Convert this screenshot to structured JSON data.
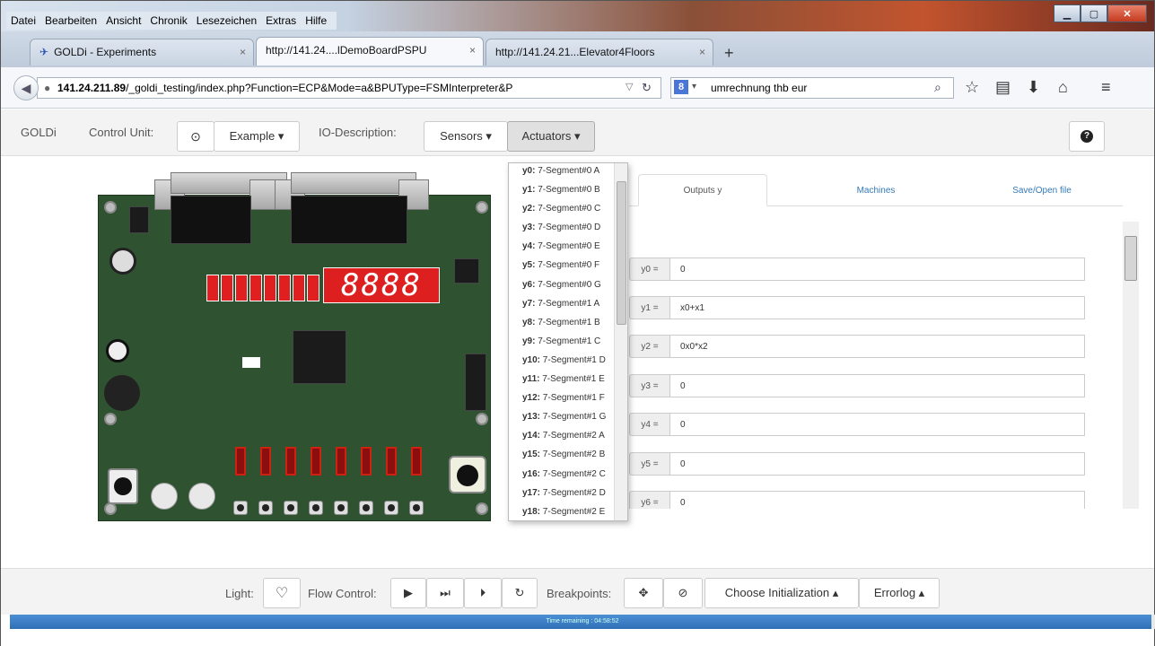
{
  "menubar": [
    "Datei",
    "Bearbeiten",
    "Ansicht",
    "Chronik",
    "Lesezeichen",
    "Extras",
    "Hilfe"
  ],
  "tabs": [
    {
      "title": "GOLDi - Experiments",
      "close": "×"
    },
    {
      "title": "http://141.24....lDemoBoardPSPU",
      "close": "×"
    },
    {
      "title": "http://141.24.21...Elevator4Floors",
      "close": "×"
    }
  ],
  "url": {
    "host": "141.24.211.89",
    "path": "/_goldi_testing/index.php?Function=ECP&Mode=a&BPUType=FSMInterpreter&P"
  },
  "search": {
    "value": "umrechnung thb eur"
  },
  "toolbar": {
    "brand": "GOLDi",
    "control_unit_label": "Control Unit:",
    "example": "Example ▾",
    "io_label": "IO-Description:",
    "sensors": "Sensors ▾",
    "actuators": "Actuators ▾"
  },
  "actuators_menu": [
    {
      "id": "y0:",
      "name": "7-Segment#0 A"
    },
    {
      "id": "y1:",
      "name": "7-Segment#0 B"
    },
    {
      "id": "y2:",
      "name": "7-Segment#0 C"
    },
    {
      "id": "y3:",
      "name": "7-Segment#0 D"
    },
    {
      "id": "y4:",
      "name": "7-Segment#0 E"
    },
    {
      "id": "y5:",
      "name": "7-Segment#0 F"
    },
    {
      "id": "y6:",
      "name": "7-Segment#0 G"
    },
    {
      "id": "y7:",
      "name": "7-Segment#1 A"
    },
    {
      "id": "y8:",
      "name": "7-Segment#1 B"
    },
    {
      "id": "y9:",
      "name": "7-Segment#1 C"
    },
    {
      "id": "y10:",
      "name": "7-Segment#1 D"
    },
    {
      "id": "y11:",
      "name": "7-Segment#1 E"
    },
    {
      "id": "y12:",
      "name": "7-Segment#1 F"
    },
    {
      "id": "y13:",
      "name": "7-Segment#1 G"
    },
    {
      "id": "y14:",
      "name": "7-Segment#2 A"
    },
    {
      "id": "y15:",
      "name": "7-Segment#2 B"
    },
    {
      "id": "y16:",
      "name": "7-Segment#2 C"
    },
    {
      "id": "y17:",
      "name": "7-Segment#2 D"
    },
    {
      "id": "y18:",
      "name": "7-Segment#2 E"
    }
  ],
  "panel_tabs": [
    "Outputs y",
    "Machines",
    "Save/Open file"
  ],
  "outputs": [
    {
      "label": "y0 =",
      "value": "0"
    },
    {
      "label": "y1 =",
      "value": "x0+x1"
    },
    {
      "label": "y2 =",
      "value": "0x0*x2"
    },
    {
      "label": "y3 =",
      "value": "0"
    },
    {
      "label": "y4 =",
      "value": "0"
    },
    {
      "label": "y5 =",
      "value": "0"
    },
    {
      "label": "y6 =",
      "value": "0"
    }
  ],
  "seven_segment_display": "8888",
  "bottom": {
    "light_label": "Light:",
    "flow_label": "Flow Control:",
    "breakpoints_label": "Breakpoints:",
    "choose_init": "Choose Initialization ▴",
    "errorlog": "Errorlog ▴",
    "time_remaining": "Time remaining : 04:58:52",
    "progress": 0.997
  }
}
